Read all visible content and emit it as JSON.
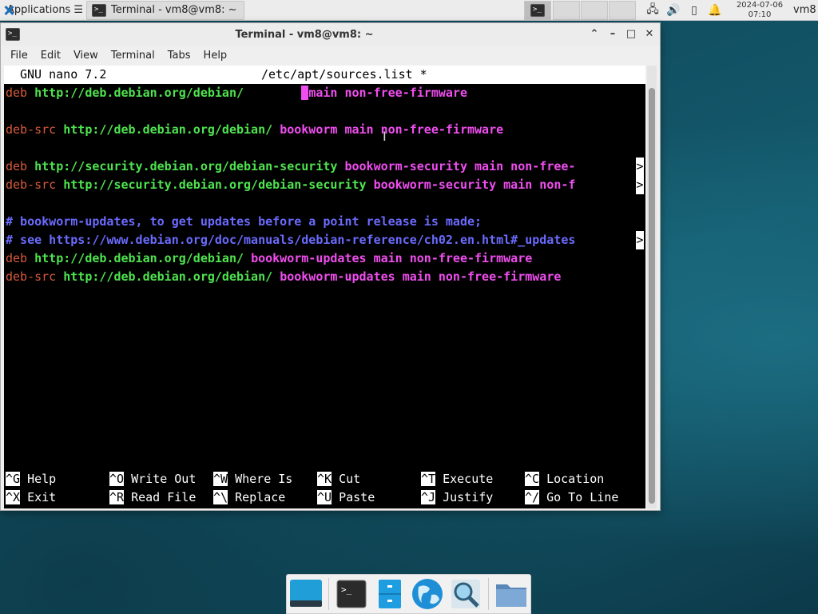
{
  "top_panel": {
    "applications_label": "Applications",
    "applications_suffix": "☰",
    "task_title": "Terminal - vm8@vm8: ~",
    "clock_date": "2024-07-06",
    "clock_time": "07:10",
    "user": "vm8"
  },
  "window": {
    "title": "Terminal - vm8@vm8: ~",
    "menu": [
      "File",
      "Edit",
      "View",
      "Terminal",
      "Tabs",
      "Help"
    ]
  },
  "nano": {
    "version": "GNU nano 7.2",
    "filename": "/etc/apt/sources.list *",
    "lines": [
      {
        "kw": "deb",
        "url": "http://deb.debian.org/debian/",
        "gap": "        ",
        "suite": "main non-free-firmware"
      },
      {
        "kw": "deb-src",
        "url": "http://deb.debian.org/debian/",
        "suite": "bookworm main non-free-firmware"
      },
      {
        "kw": "deb",
        "url": "http://security.debian.org/debian-security",
        "suite": "bookworm-security main non-free-"
      },
      {
        "kw": "deb-src",
        "url": "http://security.debian.org/debian-security",
        "suite": "bookworm-security main non-f"
      },
      {
        "comment": "# bookworm-updates, to get updates before a point release is made;"
      },
      {
        "comment": "# see https://www.debian.org/doc/manuals/debian-reference/ch02.en.html#_updates"
      },
      {
        "kw": "deb",
        "url": "http://deb.debian.org/debian/",
        "suite": "bookworm-updates main non-free-firmware"
      },
      {
        "kw": "deb-src",
        "url": "http://deb.debian.org/debian/",
        "suite": "bookworm-updates main non-free-firmware"
      }
    ],
    "overflow_marker": ">",
    "shortcuts_row1": [
      {
        "key": "^G",
        "label": "Help"
      },
      {
        "key": "^O",
        "label": "Write Out"
      },
      {
        "key": "^W",
        "label": "Where Is"
      },
      {
        "key": "^K",
        "label": "Cut"
      },
      {
        "key": "^T",
        "label": "Execute"
      },
      {
        "key": "^C",
        "label": "Location"
      }
    ],
    "shortcuts_row2": [
      {
        "key": "^X",
        "label": "Exit"
      },
      {
        "key": "^R",
        "label": "Read File"
      },
      {
        "key": "^\\",
        "label": "Replace"
      },
      {
        "key": "^U",
        "label": "Paste"
      },
      {
        "key": "^J",
        "label": "Justify"
      },
      {
        "key": "^/",
        "label": "Go To Line"
      }
    ]
  },
  "dock": {
    "items": [
      "show-desktop-icon",
      "terminal-icon",
      "file-manager-icon",
      "web-browser-icon",
      "app-finder-icon",
      "folder-icon"
    ]
  },
  "colors": {
    "keyword": "#d85a3a",
    "url": "#4fe34f",
    "suite": "#f04ef0",
    "comment": "#6b6bff"
  }
}
